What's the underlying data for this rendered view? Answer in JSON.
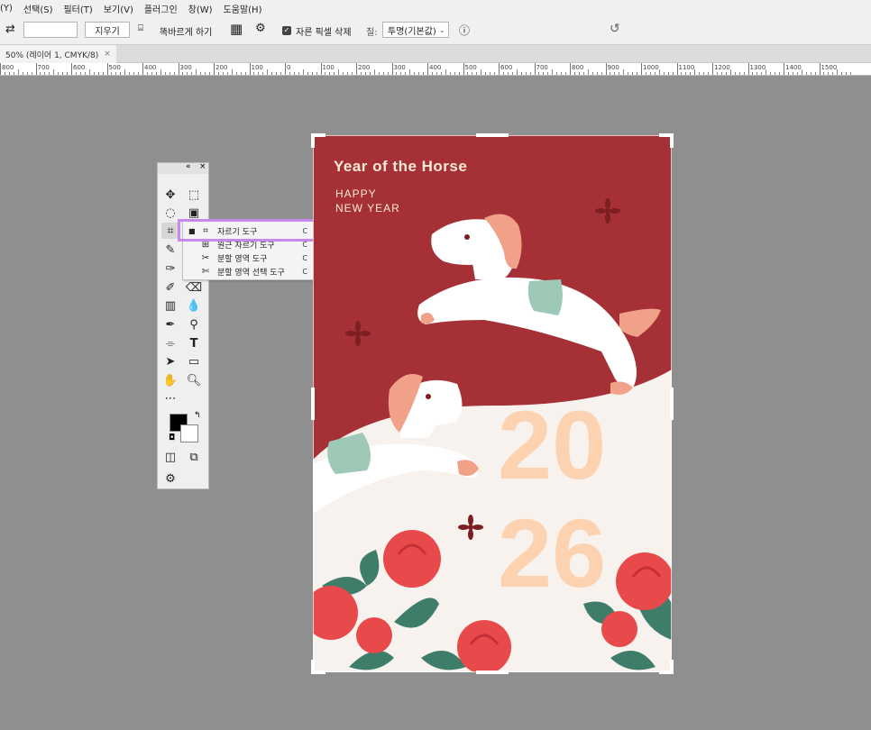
{
  "menu": [
    "(Y)",
    "선택(S)",
    "필터(T)",
    "보기(V)",
    "플러그인",
    "창(W)",
    "도움말(H)"
  ],
  "options": {
    "clear": "지우기",
    "straighten": "똑바르게 하기",
    "delete_cropped": "자른 픽셀 삭제",
    "fill_label": "칠:",
    "fill_value": "투명(기본값)"
  },
  "document_tab": {
    "title": "50% (레이어 1, CMYK/8)",
    "close": "×"
  },
  "ruler": [
    "800",
    "700",
    "600",
    "500",
    "400",
    "300",
    "200",
    "100",
    "0",
    "100",
    "200",
    "300",
    "400",
    "500",
    "600",
    "700",
    "800",
    "900",
    "1000",
    "1100",
    "1200",
    "1300",
    "1400",
    "1500"
  ],
  "flyout": [
    {
      "label": "자르기 도구",
      "shortcut": "C"
    },
    {
      "label": "원근 자르기 도구",
      "shortcut": "C"
    },
    {
      "label": "분할 영역 도구",
      "shortcut": "C"
    },
    {
      "label": "분할 영역 선택 도구",
      "shortcut": "C"
    }
  ],
  "artwork": {
    "title": "Year of the Horse",
    "greeting_1": "HAPPY",
    "greeting_2": "NEW YEAR",
    "year_top": "20",
    "year_bottom": "26"
  },
  "colors": {
    "background": "#a53035",
    "cream": "#fcd2b0",
    "highlight": "#c58bec"
  }
}
